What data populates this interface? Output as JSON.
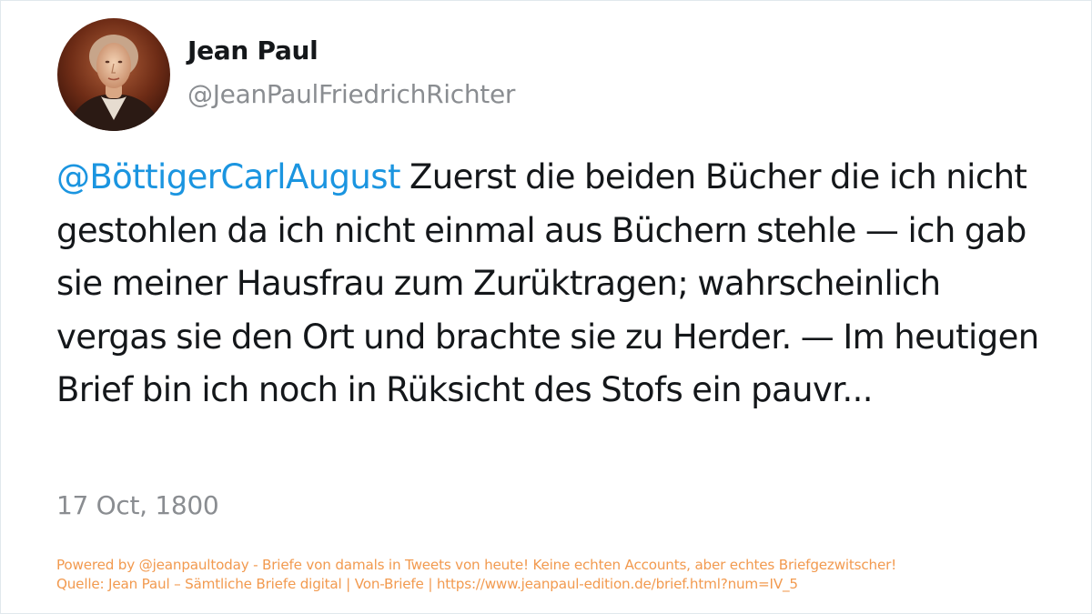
{
  "profile": {
    "display_name": "Jean Paul",
    "handle": "@JeanPaulFriedrichRichter",
    "avatar_icon": "portrait-avatar"
  },
  "tweet": {
    "mention": "@BöttigerCarlAugust",
    "body": " Zuerst die beiden Bücher die ich nicht gestohlen da ich nicht einmal aus Büchern stehle — ich gab sie meiner Hausfrau zum Zurüktragen; wahrscheinlich vergas sie den Ort und brachte sie zu Herder. — Im heutigen Brief bin ich noch in Rüksicht des Stofs ein pauvr...",
    "timestamp": "17 Oct, 1800"
  },
  "footer": {
    "line1": "Powered by @jeanpaultoday - Briefe von damals in Tweets von heute! Keine echten Accounts, aber echtes Briefgezwitscher!",
    "line2": "Quelle: Jean Paul – Sämtliche Briefe digital | Von-Briefe | https://www.jeanpaul-edition.de/brief.html?num=IV_5"
  },
  "colors": {
    "mention": "#1b95e0",
    "text": "#14171a",
    "muted": "#8a8d91",
    "footer": "#f29a4f"
  }
}
